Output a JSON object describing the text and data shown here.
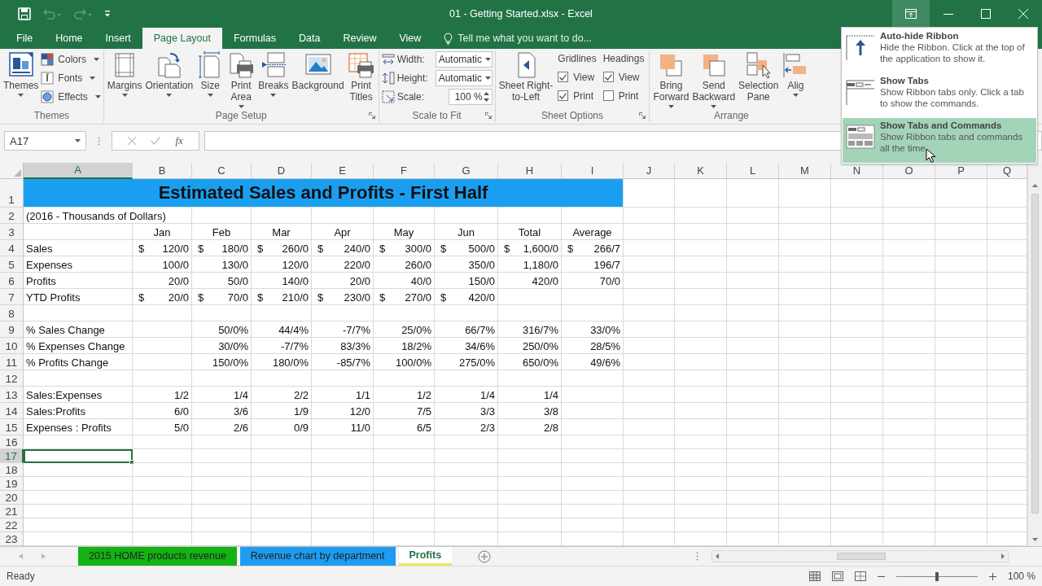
{
  "window": {
    "title": "01 - Getting Started.xlsx - Excel"
  },
  "quick_access": [
    {
      "kind": "save",
      "disabled": false
    },
    {
      "kind": "undo",
      "disabled": true
    },
    {
      "kind": "redo",
      "disabled": true
    },
    {
      "kind": "customize",
      "disabled": false
    }
  ],
  "window_buttons": [
    {
      "kind": "ribbon-options",
      "active": true
    },
    {
      "kind": "minimize",
      "active": false
    },
    {
      "kind": "maximize",
      "active": false
    },
    {
      "kind": "close",
      "active": false
    }
  ],
  "tabs": [
    {
      "label": "File",
      "selected": false
    },
    {
      "label": "Home",
      "selected": false
    },
    {
      "label": "Insert",
      "selected": false
    },
    {
      "label": "Page Layout",
      "selected": true
    },
    {
      "label": "Formulas",
      "selected": false
    },
    {
      "label": "Data",
      "selected": false
    },
    {
      "label": "Review",
      "selected": false
    },
    {
      "label": "View",
      "selected": false
    }
  ],
  "tell_me": {
    "placeholder": "Tell me what you want to do..."
  },
  "ribbon": {
    "groups": [
      {
        "label": "Themes",
        "launcher": false,
        "items": [
          {
            "kind": "large",
            "label": "Themes",
            "menu": true
          },
          {
            "kind": "stack",
            "items": [
              {
                "label": "Colors",
                "menu": true
              },
              {
                "label": "Fonts",
                "menu": true
              },
              {
                "label": "Effects",
                "menu": true
              }
            ]
          }
        ]
      },
      {
        "label": "Page Setup",
        "launcher": true,
        "items": [
          {
            "kind": "large",
            "label": "Margins",
            "menu": true
          },
          {
            "kind": "large",
            "label": "Orientation",
            "menu": true
          },
          {
            "kind": "large",
            "label": "Size",
            "menu": true
          },
          {
            "kind": "large",
            "label": "Print\nArea",
            "menu": true
          },
          {
            "kind": "large",
            "label": "Breaks",
            "menu": true
          },
          {
            "kind": "large",
            "label": "Background",
            "menu": false
          },
          {
            "kind": "large",
            "label": "Print\nTitles",
            "menu": false
          }
        ]
      },
      {
        "label": "Scale to Fit",
        "launcher": true,
        "items": [
          {
            "kind": "fields",
            "items": [
              {
                "label": "Width:",
                "value": "Automatic",
                "kind": "dropdown"
              },
              {
                "label": "Height:",
                "value": "Automatic",
                "kind": "dropdown"
              },
              {
                "label": "Scale:",
                "value": "100 %",
                "kind": "spinner"
              }
            ]
          }
        ]
      },
      {
        "label": "Sheet Options",
        "launcher": true,
        "items": [
          {
            "kind": "large",
            "label": "Sheet Right-\nto-Left",
            "menu": false
          },
          {
            "kind": "checks",
            "title": "Gridlines",
            "items": [
              {
                "label": "View",
                "checked": true
              },
              {
                "label": "Print",
                "checked": true
              }
            ]
          },
          {
            "kind": "checks",
            "title": "Headings",
            "items": [
              {
                "label": "View",
                "checked": true
              },
              {
                "label": "Print",
                "checked": false
              }
            ]
          }
        ]
      },
      {
        "label": "Arrange",
        "launcher": false,
        "items": [
          {
            "kind": "large",
            "label": "Bring\nForward",
            "menu": true
          },
          {
            "kind": "large",
            "label": "Send\nBackward",
            "menu": true
          },
          {
            "kind": "large",
            "label": "Selection\nPane",
            "menu": false
          },
          {
            "kind": "large",
            "label": "Alig",
            "menu": true
          }
        ]
      }
    ]
  },
  "ribbon_menu": {
    "items": [
      {
        "title": "Auto-hide Ribbon",
        "description": "Hide the Ribbon. Click at the top of the application to show it.",
        "selected": false
      },
      {
        "title": "Show Tabs",
        "description": "Show Ribbon tabs only. Click a tab to show the commands.",
        "selected": false
      },
      {
        "title": "Show Tabs and Commands",
        "description": "Show Ribbon tabs and commands all the time.",
        "selected": true
      }
    ]
  },
  "formula_bar": {
    "name_box": "A17",
    "function_label": "fx"
  },
  "sheet": {
    "columns": [
      {
        "label": "A",
        "selected": true
      },
      {
        "label": "B",
        "selected": false
      },
      {
        "label": "C",
        "selected": false
      },
      {
        "label": "D",
        "selected": false
      },
      {
        "label": "E",
        "selected": false
      },
      {
        "label": "F",
        "selected": false
      },
      {
        "label": "G",
        "selected": false
      },
      {
        "label": "H",
        "selected": false
      },
      {
        "label": "I",
        "selected": false
      },
      {
        "label": "J",
        "selected": false
      },
      {
        "label": "K",
        "selected": false
      },
      {
        "label": "L",
        "selected": false
      },
      {
        "label": "M",
        "selected": false
      },
      {
        "label": "N",
        "selected": false
      },
      {
        "label": "O",
        "selected": false
      },
      {
        "label": "P",
        "selected": false
      },
      {
        "label": "Q",
        "selected": false
      }
    ],
    "rows": [
      {
        "number": "1",
        "kind": "title",
        "selected": false,
        "cells": [
          {
            "kind": "title",
            "text": "Estimated Sales and Profits - First Half",
            "colspan": 9
          }
        ]
      },
      {
        "number": "2",
        "kind": "data",
        "selected": false,
        "cells": [
          {
            "kind": "text",
            "text": "(2016 - Thousands of Dollars)",
            "colspan": 2
          }
        ]
      },
      {
        "number": "3",
        "kind": "heading",
        "selected": false,
        "cells": [
          null,
          "Jan",
          "Feb",
          "Mar",
          "Apr",
          "May",
          "Jun",
          "Total",
          "Average"
        ]
      },
      {
        "number": "4",
        "kind": "data",
        "selected": false,
        "cells": [
          "Sales",
          {
            "kind": "currency",
            "symbol": "$",
            "value": "120/0"
          },
          {
            "kind": "currency",
            "symbol": "$",
            "value": "180/0"
          },
          {
            "kind": "currency",
            "symbol": "$",
            "value": "260/0"
          },
          {
            "kind": "currency",
            "symbol": "$",
            "value": "240/0"
          },
          {
            "kind": "currency",
            "symbol": "$",
            "value": "300/0"
          },
          {
            "kind": "currency",
            "symbol": "$",
            "value": "500/0"
          },
          {
            "kind": "currency",
            "symbol": "$",
            "value": "1,600/0"
          },
          {
            "kind": "currency",
            "symbol": "$",
            "value": "266/7"
          }
        ]
      },
      {
        "number": "5",
        "kind": "data",
        "selected": false,
        "cells": [
          "Expenses",
          "100/0",
          "130/0",
          "120/0",
          "220/0",
          "260/0",
          "350/0",
          "1,180/0",
          "196/7"
        ]
      },
      {
        "number": "6",
        "kind": "data",
        "selected": false,
        "cells": [
          "Profits",
          "20/0",
          "50/0",
          "140/0",
          "20/0",
          "40/0",
          "150/0",
          "420/0",
          "70/0"
        ]
      },
      {
        "number": "7",
        "kind": "data",
        "selected": false,
        "cells": [
          "YTD Profits",
          {
            "kind": "currency",
            "symbol": "$",
            "value": "20/0"
          },
          {
            "kind": "currency",
            "symbol": "$",
            "value": "70/0"
          },
          {
            "kind": "currency",
            "symbol": "$",
            "value": "210/0"
          },
          {
            "kind": "currency",
            "symbol": "$",
            "value": "230/0"
          },
          {
            "kind": "currency",
            "symbol": "$",
            "value": "270/0"
          },
          {
            "kind": "currency",
            "symbol": "$",
            "value": "420/0"
          }
        ]
      },
      {
        "number": "8",
        "kind": "data",
        "selected": false,
        "cells": []
      },
      {
        "number": "9",
        "kind": "data",
        "selected": false,
        "cells": [
          "% Sales Change",
          null,
          "50/0%",
          "44/4%",
          "-7/7%",
          "25/0%",
          "66/7%",
          "316/7%",
          "33/0%"
        ]
      },
      {
        "number": "10",
        "kind": "data",
        "selected": false,
        "cells": [
          "% Expenses Change",
          null,
          "30/0%",
          "-7/7%",
          "83/3%",
          "18/2%",
          "34/6%",
          "250/0%",
          "28/5%"
        ]
      },
      {
        "number": "11",
        "kind": "data",
        "selected": false,
        "cells": [
          "% Profits Change",
          null,
          "150/0%",
          "180/0%",
          "-85/7%",
          "100/0%",
          "275/0%",
          "650/0%",
          "49/6%"
        ]
      },
      {
        "number": "12",
        "kind": "data",
        "selected": false,
        "cells": []
      },
      {
        "number": "13",
        "kind": "data",
        "selected": false,
        "cells": [
          "Sales:Expenses",
          "1/2",
          "1/4",
          "2/2",
          "1/1",
          "1/2",
          "1/4",
          "1/4"
        ]
      },
      {
        "number": "14",
        "kind": "data",
        "selected": false,
        "cells": [
          "Sales:Profits",
          "6/0",
          "3/6",
          "1/9",
          "12/0",
          "7/5",
          "3/3",
          "3/8"
        ]
      },
      {
        "number": "15",
        "kind": "data",
        "selected": false,
        "cells": [
          "Expenses : Profits",
          "5/0",
          "2/6",
          "0/9",
          "11/0",
          "6/5",
          "2/3",
          "2/8"
        ]
      },
      {
        "number": "16",
        "kind": "data",
        "selected": false,
        "cells": []
      },
      {
        "number": "17",
        "kind": "data",
        "selected": true,
        "cells": []
      },
      {
        "number": "18",
        "kind": "data",
        "selected": false,
        "cells": []
      },
      {
        "number": "19",
        "kind": "data",
        "selected": false,
        "cells": []
      },
      {
        "number": "20",
        "kind": "data",
        "selected": false,
        "cells": []
      },
      {
        "number": "21",
        "kind": "data",
        "selected": false,
        "cells": []
      },
      {
        "number": "22",
        "kind": "data",
        "selected": false,
        "cells": []
      },
      {
        "number": "23",
        "kind": "data",
        "selected": false,
        "cells": []
      }
    ]
  },
  "sheet_tabs": [
    {
      "label": "2015 HOME products revenue",
      "color": "#12b312",
      "selected": false
    },
    {
      "label": "Revenue chart by department",
      "color": "#1e9cf0",
      "selected": false
    },
    {
      "label": "Profits",
      "color": "#f2e65a",
      "selected": true
    }
  ],
  "status_bar": {
    "text": "Ready",
    "zoom": "100 %",
    "zoom_slider": {
      "level": 0.5
    }
  }
}
